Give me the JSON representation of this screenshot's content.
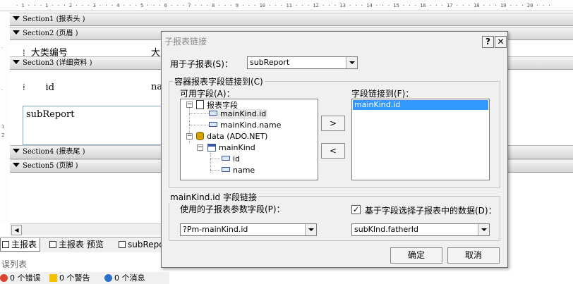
{
  "designer": {
    "sections": [
      {
        "label": "Section1 (报表头  )"
      },
      {
        "label": "Section2 (页眉  )"
      },
      {
        "label": "Section3 (详细资料  )"
      },
      {
        "label": "Section4 (报表尾  )"
      },
      {
        "label": "Section5 (页脚  )"
      }
    ],
    "header_text_1": "大类编号",
    "header_text_2": "大",
    "detail_text_1": "id",
    "detail_text_2": "na",
    "subreport_text": "subReport"
  },
  "tabs": [
    {
      "label": "主报表"
    },
    {
      "label": "主报表 预览"
    },
    {
      "label": "subRepor"
    }
  ],
  "error_panel": {
    "title": "误列表",
    "errors": "0 个错误",
    "warnings": "0 个警告",
    "messages": "0 个消息"
  },
  "dialog": {
    "title": "子报表链接",
    "help_label": "?",
    "close_label": "✕",
    "subreport_label": "用于子报表(S)：",
    "subreport_value": "subReport",
    "container_group": "容器报表字段链接到(C)",
    "available_label": "可用字段(A)：",
    "linked_label": "字段链接到(F)：",
    "tree": {
      "report_fields": "报表字段",
      "field_1": "mainKind.id",
      "field_2": "mainKind.name",
      "data_source": "data (ADO.NET)",
      "table": "mainKind",
      "col_1": "id",
      "col_2": "name"
    },
    "linked_fields": [
      "mainKind.id"
    ],
    "add_button": ">",
    "remove_button": "<",
    "link_group": "mainKind.id 字段链接",
    "param_label": "使用的子报表参数字段(P)：",
    "param_value": "?Pm-mainKind.id",
    "filter_checkbox_label": "基于字段选择子报表中的数据(D)：",
    "filter_checked": true,
    "filter_value": "subKInd.fatherId",
    "ok_button": "确定",
    "cancel_button": "取消"
  },
  "colors": {
    "selection": "#3399ff",
    "dialog_bg": "#f0f0f0",
    "error_icon": "#d9432f",
    "warning_icon": "#f2c200",
    "info_icon": "#2a6fc9"
  }
}
